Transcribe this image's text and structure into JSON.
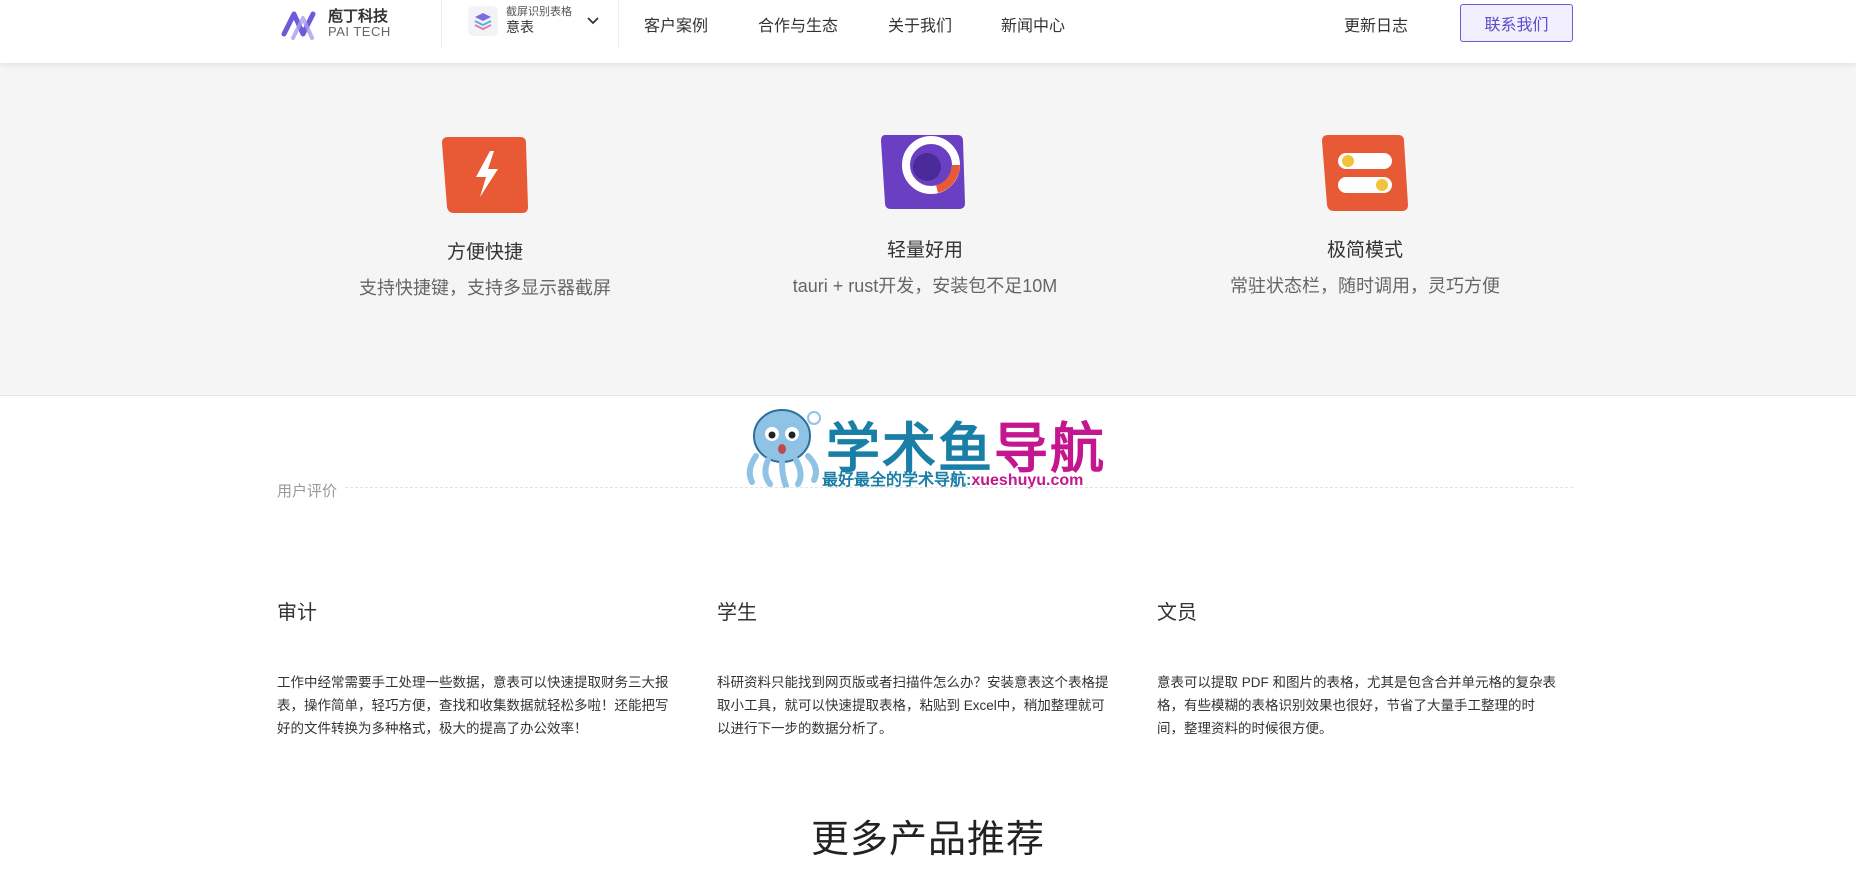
{
  "header": {
    "logo": {
      "cn": "庖丁科技",
      "en": "PAI TECH"
    },
    "product": {
      "subtitle": "截屏识别表格",
      "name": "意表"
    },
    "nav": [
      {
        "label": "客户案例"
      },
      {
        "label": "合作与生态"
      },
      {
        "label": "关于我们"
      },
      {
        "label": "新闻中心"
      }
    ],
    "changelog": "更新日志",
    "contact": "联系我们"
  },
  "features": [
    {
      "title": "方便快捷",
      "desc": "支持快捷键，支持多显示器截屏",
      "icon": "lightning-icon"
    },
    {
      "title": "轻量好用",
      "desc": "tauri + rust开发，安装包不足10M",
      "icon": "ring-icon"
    },
    {
      "title": "极简模式",
      "desc": "常驻状态栏，随时调用，灵巧方便",
      "icon": "toggle-icon"
    }
  ],
  "watermark": {
    "title_a": "学术鱼",
    "title_b": "导航",
    "sub_a": "最好最全的学术导航:",
    "sub_b": "xueshuyu.com"
  },
  "reviews": {
    "label": "用户评价",
    "items": [
      {
        "title": "审计",
        "text": "工作中经常需要手工处理一些数据，意表可以快速提取财务三大报表，操作简单，轻巧方便，查找和收集数据就轻松多啦！还能把写好的文件转换为多种格式，极大的提高了办公效率！"
      },
      {
        "title": "学生",
        "text": "科研资料只能找到网页版或者扫描件怎么办？安装意表这个表格提取小工具，就可以快速提取表格，粘贴到 Excel中，稍加整理就可以进行下一步的数据分析了。"
      },
      {
        "title": "文员",
        "text": "意表可以提取 PDF 和图片的表格，尤其是包含合并单元格的复杂表格，有些模糊的表格识别效果也很好，节省了大量手工整理的时间，整理资料的时候很方便。"
      }
    ]
  },
  "more": {
    "title": "更多产品推荐"
  },
  "colors": {
    "accent": "#6b5bd6",
    "feature_orange": "#e85a35",
    "feature_purple": "#6a3fc2",
    "watermark_blue": "#1a7fa6",
    "watermark_magenta": "#c4168f"
  }
}
